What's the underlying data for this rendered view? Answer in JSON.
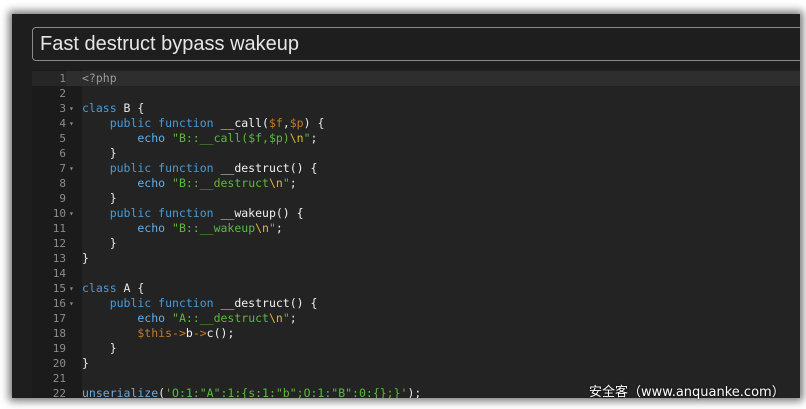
{
  "title": "Fast destruct bypass wakeup",
  "watermark": "安全客（www.anquanke.com）",
  "editor": {
    "active_line": 1,
    "lines": [
      {
        "n": "1",
        "fold": false,
        "tokens": [
          {
            "t": "<?php",
            "c": "tag"
          }
        ]
      },
      {
        "n": "2",
        "fold": false,
        "tokens": []
      },
      {
        "n": "3",
        "fold": true,
        "tokens": [
          {
            "t": "class",
            "c": "kw"
          },
          {
            "t": " B {",
            "c": "plain"
          }
        ]
      },
      {
        "n": "4",
        "fold": true,
        "tokens": [
          {
            "t": "    public function",
            "c": "kw"
          },
          {
            "t": " __call(",
            "c": "id"
          },
          {
            "t": "$f",
            "c": "var"
          },
          {
            "t": ",",
            "c": "plain"
          },
          {
            "t": "$p",
            "c": "var"
          },
          {
            "t": ") {",
            "c": "plain"
          }
        ]
      },
      {
        "n": "5",
        "fold": false,
        "tokens": [
          {
            "t": "        echo",
            "c": "echo"
          },
          {
            "t": " ",
            "c": "plain"
          },
          {
            "t": "\"B::__call($f,$p)",
            "c": "str"
          },
          {
            "t": "\\n",
            "c": "esc"
          },
          {
            "t": "\"",
            "c": "str"
          },
          {
            "t": ";",
            "c": "plain"
          }
        ]
      },
      {
        "n": "6",
        "fold": false,
        "tokens": [
          {
            "t": "    }",
            "c": "plain"
          }
        ]
      },
      {
        "n": "7",
        "fold": true,
        "tokens": [
          {
            "t": "    public function",
            "c": "kw"
          },
          {
            "t": " __destruct() {",
            "c": "id"
          }
        ]
      },
      {
        "n": "8",
        "fold": false,
        "tokens": [
          {
            "t": "        echo",
            "c": "echo"
          },
          {
            "t": " ",
            "c": "plain"
          },
          {
            "t": "\"B::__destruct",
            "c": "str"
          },
          {
            "t": "\\n",
            "c": "esc"
          },
          {
            "t": "\"",
            "c": "str"
          },
          {
            "t": ";",
            "c": "plain"
          }
        ]
      },
      {
        "n": "9",
        "fold": false,
        "tokens": [
          {
            "t": "    }",
            "c": "plain"
          }
        ]
      },
      {
        "n": "10",
        "fold": true,
        "tokens": [
          {
            "t": "    public function",
            "c": "kw"
          },
          {
            "t": " __wakeup() {",
            "c": "id"
          }
        ]
      },
      {
        "n": "11",
        "fold": false,
        "tokens": [
          {
            "t": "        echo",
            "c": "echo"
          },
          {
            "t": " ",
            "c": "plain"
          },
          {
            "t": "\"B::__wakeup",
            "c": "str"
          },
          {
            "t": "\\n",
            "c": "esc"
          },
          {
            "t": "\"",
            "c": "str"
          },
          {
            "t": ";",
            "c": "plain"
          }
        ]
      },
      {
        "n": "12",
        "fold": false,
        "tokens": [
          {
            "t": "    }",
            "c": "plain"
          }
        ]
      },
      {
        "n": "13",
        "fold": false,
        "tokens": [
          {
            "t": "}",
            "c": "plain"
          }
        ]
      },
      {
        "n": "14",
        "fold": false,
        "tokens": []
      },
      {
        "n": "15",
        "fold": true,
        "tokens": [
          {
            "t": "class",
            "c": "kw"
          },
          {
            "t": " A {",
            "c": "plain"
          }
        ]
      },
      {
        "n": "16",
        "fold": true,
        "tokens": [
          {
            "t": "    public function",
            "c": "kw"
          },
          {
            "t": " __destruct() {",
            "c": "id"
          }
        ]
      },
      {
        "n": "17",
        "fold": false,
        "tokens": [
          {
            "t": "        echo",
            "c": "echo"
          },
          {
            "t": " ",
            "c": "plain"
          },
          {
            "t": "\"A::__destruct",
            "c": "str"
          },
          {
            "t": "\\n",
            "c": "esc"
          },
          {
            "t": "\"",
            "c": "str"
          },
          {
            "t": ";",
            "c": "plain"
          }
        ]
      },
      {
        "n": "18",
        "fold": false,
        "tokens": [
          {
            "t": "        $this",
            "c": "var"
          },
          {
            "t": "->",
            "c": "op"
          },
          {
            "t": "b",
            "c": "id"
          },
          {
            "t": "->",
            "c": "op"
          },
          {
            "t": "c();",
            "c": "id"
          }
        ]
      },
      {
        "n": "19",
        "fold": false,
        "tokens": [
          {
            "t": "    }",
            "c": "plain"
          }
        ]
      },
      {
        "n": "20",
        "fold": false,
        "tokens": [
          {
            "t": "}",
            "c": "plain"
          }
        ]
      },
      {
        "n": "21",
        "fold": false,
        "tokens": []
      },
      {
        "n": "22",
        "fold": false,
        "tokens": [
          {
            "t": "unserialize",
            "c": "fn-ul"
          },
          {
            "t": "(",
            "c": "plain"
          },
          {
            "t": "'O:1:\"A\":1:{s:1:\"b\";O:1:\"B\":0:{};}'",
            "c": "str"
          },
          {
            "t": ");",
            "c": "plain"
          }
        ]
      }
    ]
  }
}
